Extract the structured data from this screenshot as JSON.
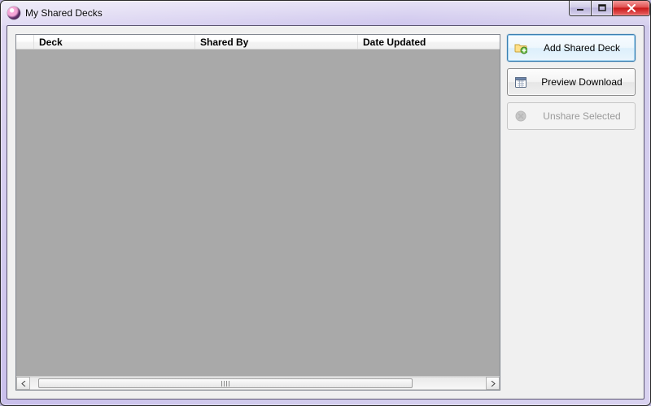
{
  "window": {
    "title": "My Shared Decks"
  },
  "table": {
    "columns": {
      "deck": "Deck",
      "shared_by": "Shared By",
      "date_updated": "Date Updated"
    },
    "rows": []
  },
  "actions": {
    "add": {
      "label": "Add Shared Deck",
      "enabled": true,
      "focused": true
    },
    "preview": {
      "label": "Preview Download",
      "enabled": true,
      "focused": false
    },
    "unshare": {
      "label": "Unshare Selected",
      "enabled": false,
      "focused": false
    }
  },
  "icons": {
    "add": "folder-add-icon",
    "preview": "calendar-icon",
    "unshare": "cancel-circle-icon",
    "app": "orb-icon"
  }
}
